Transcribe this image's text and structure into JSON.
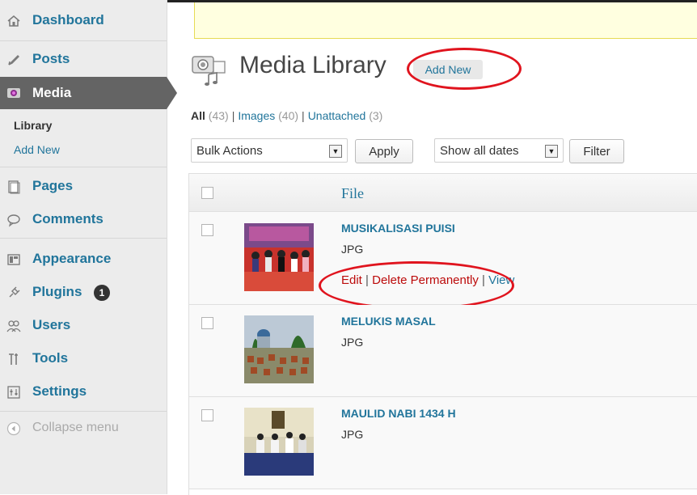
{
  "sidebar": {
    "items": [
      {
        "label": "Dashboard",
        "icon": "dashboard-icon"
      },
      {
        "label": "Posts",
        "icon": "posts-icon"
      },
      {
        "label": "Media",
        "icon": "media-icon"
      },
      {
        "label": "Pages",
        "icon": "pages-icon"
      },
      {
        "label": "Comments",
        "icon": "comments-icon"
      },
      {
        "label": "Appearance",
        "icon": "appearance-icon"
      },
      {
        "label": "Plugins",
        "icon": "plugins-icon",
        "badge": "1"
      },
      {
        "label": "Users",
        "icon": "users-icon"
      },
      {
        "label": "Tools",
        "icon": "tools-icon"
      },
      {
        "label": "Settings",
        "icon": "settings-icon"
      }
    ],
    "media_submenu": {
      "library": "Library",
      "add_new": "Add New"
    },
    "collapse_label": "Collapse menu"
  },
  "header": {
    "title": "Media Library",
    "add_new": "Add New"
  },
  "filters": {
    "all": "All",
    "all_count": "(43)",
    "images": "Images",
    "images_count": "(40)",
    "unattached": "Unattached",
    "unattached_count": "(3)",
    "sep": "|"
  },
  "toolbar": {
    "bulk_actions": "Bulk Actions",
    "apply": "Apply",
    "dates": "Show all dates",
    "filter": "Filter"
  },
  "table": {
    "column_file": "File",
    "rows": [
      {
        "title": "MUSIKALISASI PUISI",
        "ext": "JPG",
        "actions": {
          "edit": "Edit",
          "delete": "Delete Permanently",
          "view": "View",
          "sep": "|"
        }
      },
      {
        "title": "MELUKIS MASAL",
        "ext": "JPG"
      },
      {
        "title": "MAULID NABI 1434 H",
        "ext": "JPG"
      }
    ]
  },
  "colors": {
    "link": "#21759b",
    "delete": "#bc0b0b",
    "highlight_ellipse": "#e0141e",
    "active_menu": "#646464"
  }
}
